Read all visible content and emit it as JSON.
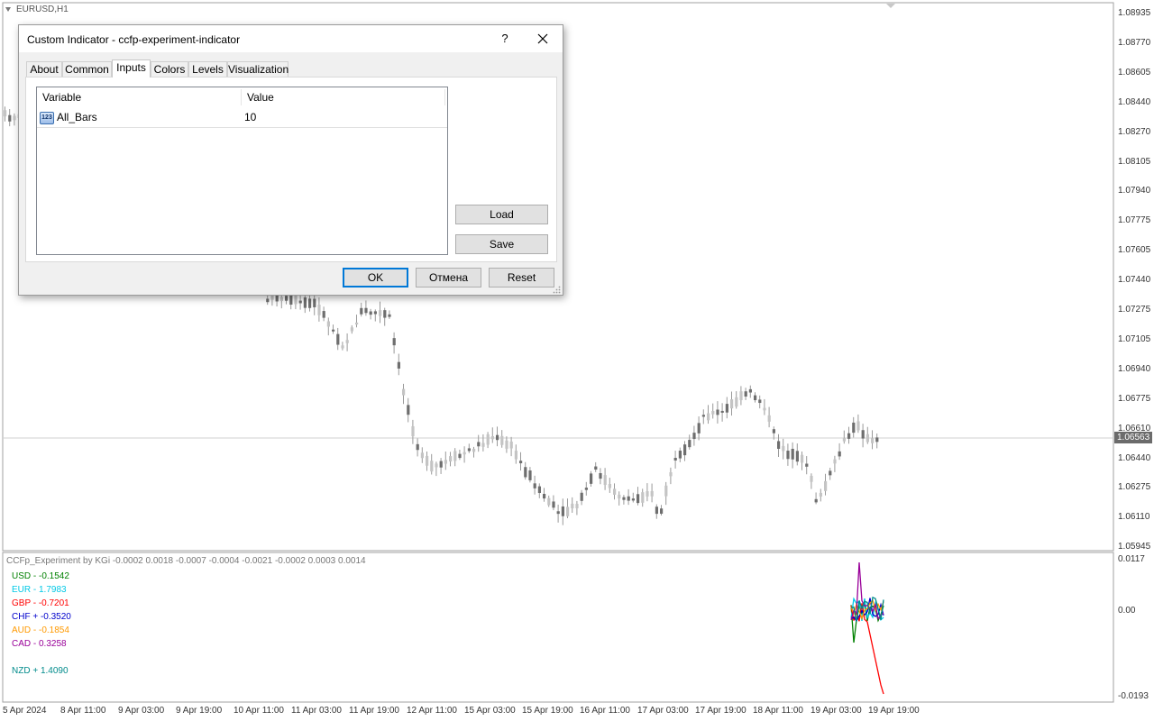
{
  "chart": {
    "symbol": "EURUSD,H1",
    "current_price": "1.06563",
    "price_labels": [
      "1.08935",
      "1.08770",
      "1.08605",
      "1.08440",
      "1.08270",
      "1.08105",
      "1.07940",
      "1.07775",
      "1.07605",
      "1.07440",
      "1.07275",
      "1.07105",
      "1.06940",
      "1.06775",
      "1.06610",
      "1.06440",
      "1.06275",
      "1.06110",
      "1.05945"
    ],
    "time_labels": [
      "5 Apr 2024",
      "8 Apr 11:00",
      "9 Apr 03:00",
      "9 Apr 19:00",
      "10 Apr 11:00",
      "11 Apr 03:00",
      "11 Apr 19:00",
      "12 Apr 11:00",
      "15 Apr 03:00",
      "15 Apr 19:00",
      "16 Apr 11:00",
      "17 Apr 03:00",
      "17 Apr 19:00",
      "18 Apr 11:00",
      "19 Apr 03:00",
      "19 Apr 19:00"
    ]
  },
  "indicator": {
    "title": "CCFp_Experiment by KGi -0.0002 0.0018 -0.0007 -0.0004 -0.0021 -0.0002 0.0003 0.0014",
    "scale_labels": [
      "0.0117",
      "0.00",
      "-0.0193"
    ],
    "legend": [
      {
        "text": "USD -  -0.1542",
        "color": "#008000"
      },
      {
        "text": "EUR -  1.7983",
        "color": "#00c8e6"
      },
      {
        "text": "GBP -  -0.7201",
        "color": "#ff0000"
      },
      {
        "text": "CHF +  -0.3520",
        "color": "#0000cc"
      },
      {
        "text": "AUD -  -0.1854",
        "color": "#ff9900"
      },
      {
        "text": "CAD -  0.3258",
        "color": "#990099"
      },
      {
        "text": "NZD +  1.4090",
        "color": "#008b8b"
      }
    ]
  },
  "dialog": {
    "title": "Custom Indicator - ccfp-experiment-indicator",
    "help": "?",
    "tabs": [
      "About",
      "Common",
      "Inputs",
      "Colors",
      "Levels",
      "Visualization"
    ],
    "active_tab": "Inputs",
    "grid": {
      "col_variable": "Variable",
      "col_value": "Value",
      "rows": [
        {
          "icon": "123",
          "variable": "All_Bars",
          "value": "10"
        }
      ]
    },
    "buttons": {
      "load": "Load",
      "save": "Save",
      "ok": "OK",
      "cancel": "Отмена",
      "reset": "Reset"
    }
  }
}
